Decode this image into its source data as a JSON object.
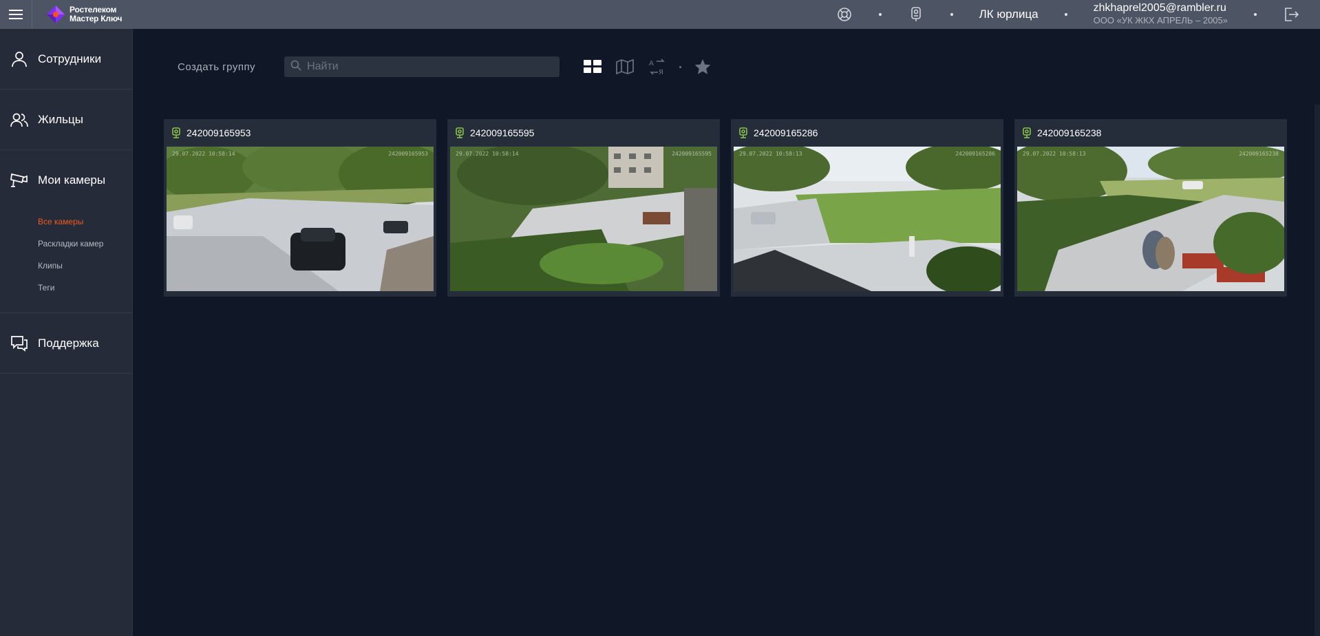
{
  "header": {
    "logo_line1": "Ростелеком",
    "logo_line2": "Мастер Ключ",
    "org_label": "ЛК юрлица",
    "account_email": "zhkhaprel2005@rambler.ru",
    "account_org": "ООО «УК ЖКХ АПРЕЛЬ – 2005»",
    "icons": [
      "menu-icon",
      "support-ring-icon",
      "intercom-icon",
      "logout-icon"
    ]
  },
  "sidebar": {
    "items": [
      {
        "label": "Сотрудники",
        "icon": "person-icon"
      },
      {
        "label": "Жильцы",
        "icon": "people-icon"
      },
      {
        "label": "Мои камеры",
        "icon": "camera-icon"
      },
      {
        "label": "Поддержка",
        "icon": "chat-icon"
      }
    ],
    "sub_items": [
      {
        "label": "Все камеры",
        "active": true
      },
      {
        "label": "Раскладки камер",
        "active": false
      },
      {
        "label": "Клипы",
        "active": false
      },
      {
        "label": "Теги",
        "active": false
      }
    ]
  },
  "toolbar": {
    "create_group": "Создать группу",
    "search_placeholder": "Найти",
    "view_icons": [
      "grid-view-icon",
      "map-view-icon",
      "sort-alpha-icon",
      "favorites-star-icon"
    ]
  },
  "cameras": [
    {
      "id": "242009165953",
      "date_stamp": "29.07.2022 10:58:14",
      "status_color": "#8bc34a"
    },
    {
      "id": "242009165595",
      "date_stamp": "29.07.2022 10:58:14",
      "status_color": "#8bc34a"
    },
    {
      "id": "242009165286",
      "date_stamp": "29.07.2022 10:58:13",
      "status_color": "#8bc34a"
    },
    {
      "id": "242009165238",
      "date_stamp": "29.07.2022 10:58:13",
      "status_color": "#8bc34a"
    }
  ],
  "colors": {
    "accent": "#ee5a24",
    "topbar": "#4d5564",
    "sidebar": "#252b38",
    "background": "#101827",
    "online": "#8bc34a"
  }
}
